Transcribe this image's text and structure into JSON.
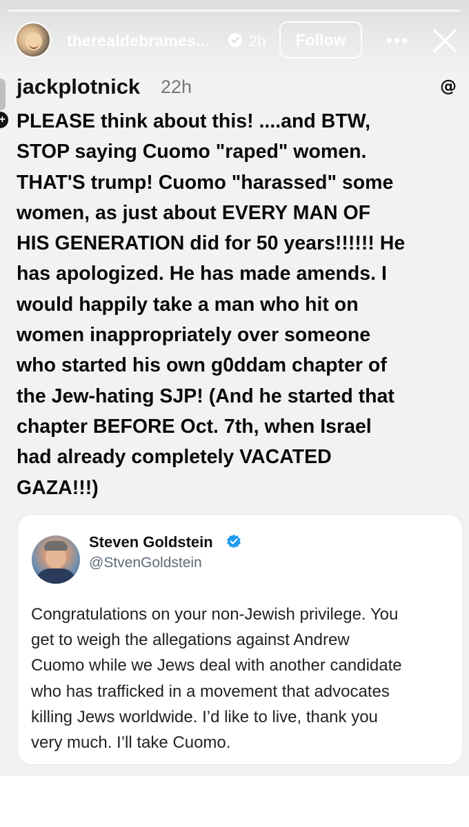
{
  "story": {
    "username": "therealdebrames...",
    "time": "2h",
    "follow_label": "Follow",
    "more_icon": "more-icon",
    "close_icon": "close-icon"
  },
  "post": {
    "handle": "jackplotnick",
    "time": "22h",
    "text": "PLEASE think about this! ....and BTW,\nSTOP saying Cuomo \"raped\" women.\nTHAT'S trump! Cuomo \"harassed\" some\nwomen, as just about EVERY MAN OF\nHIS GENERATION did for 50 years!!!!!! He\nhas apologized. He has made amends. I\nwould happily take a man who hit on\nwomen inappropriately over someone\nwho started his own g0ddam chapter of\nthe Jew-hating SJP! (And he started that\nchapter BEFORE Oct. 7th, when Israel\nhad already completely VACATED\nGAZA!!!)",
    "threads_icon": "@"
  },
  "tweet": {
    "name": "Steven Goldstein",
    "handle": "@StvenGoldstein",
    "text": "Congratulations on your non-Jewish privilege.  You\nget to weigh the allegations against Andrew\nCuomo while we Jews deal with another candidate\nwho has trafficked in a movement that advocates\nkilling Jews worldwide.  I’d like to live, thank you\nvery much.  I’ll take Cuomo."
  },
  "colors": {
    "verified_blue": "#1d9bf0",
    "text_primary": "#0a0a0a",
    "text_secondary": "#5b6b7a"
  }
}
